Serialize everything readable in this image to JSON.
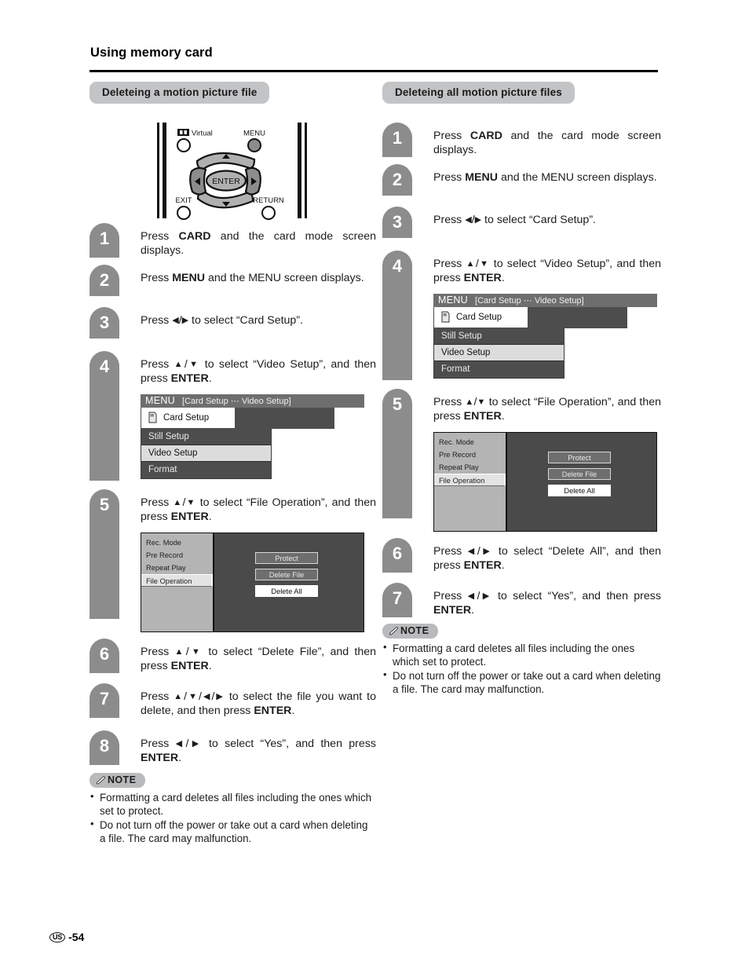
{
  "page": {
    "title": "Using memory card",
    "footer_region": "US",
    "footer_page": "-54"
  },
  "left_section": {
    "heading": "Deleteing a motion picture file",
    "remote": {
      "label_virtual": "Virtual",
      "label_menu": "MENU",
      "label_exit": "EXIT",
      "label_return": "RETURN",
      "label_enter": "ENTER"
    },
    "steps": [
      {
        "num": "1",
        "html": "Press <b>CARD</b> and the card mode screen displays."
      },
      {
        "num": "2",
        "html": "Press <b>MENU</b> and the MENU screen displays."
      },
      {
        "num": "3",
        "html": "Press <span class=\"arrow\">◀</span>/<span class=\"arrow\">▶</span> to select “Card Setup”."
      },
      {
        "num": "4",
        "html": "Press <span class=\"arrow\">▲</span>/<span class=\"arrow\">▼</span> to select “Video Setup”, and then press <b>ENTER</b>."
      },
      {
        "num": "5",
        "html": "Press <span class=\"arrow\">▲</span>/<span class=\"arrow\">▼</span> to select “File Operation”, and then press <b>ENTER</b>."
      },
      {
        "num": "6",
        "html": "Press <span class=\"arrow\">▲</span>/<span class=\"arrow\">▼</span> to select “Delete File”, and then press <b>ENTER</b>."
      },
      {
        "num": "7",
        "html": "Press <span class=\"arrow\">▲</span>/<span class=\"arrow\">▼</span>/<span class=\"arrow\">◀</span>/<span class=\"arrow\">▶</span> to select the file you want to delete, and then press <b>ENTER</b>."
      },
      {
        "num": "8",
        "html": "Press <span class=\"arrow\">◀</span>/<span class=\"arrow\">▶</span> to select “Yes”, and then press <b>ENTER</b>."
      }
    ],
    "note": {
      "badge": "NOTE",
      "items": [
        "Formatting a card deletes all files including the ones which set to protect.",
        "Do not turn off the power or take out a card when deleting a file. The card may malfunction."
      ]
    }
  },
  "right_section": {
    "heading": "Deleteing all motion picture files",
    "steps": [
      {
        "num": "1",
        "html": "Press <b>CARD</b> and the card mode screen displays."
      },
      {
        "num": "2",
        "html": "Press <b>MENU</b> and the MENU screen displays."
      },
      {
        "num": "3",
        "html": "Press <span class=\"arrow\">◀</span>/<span class=\"arrow\">▶</span> to select “Card Setup”."
      },
      {
        "num": "4",
        "html": "Press <span class=\"arrow\">▲</span>/<span class=\"arrow\">▼</span> to select “Video Setup”, and then press <b>ENTER</b>."
      },
      {
        "num": "5",
        "html": "Press <span class=\"arrow\">▲</span>/<span class=\"arrow\">▼</span> to select “File Operation”, and then press <b>ENTER</b>."
      },
      {
        "num": "6",
        "html": "Press <span class=\"arrow\">◀</span>/<span class=\"arrow\">▶</span> to select “Delete All”, and then press <b>ENTER</b>."
      },
      {
        "num": "7",
        "html": "Press <span class=\"arrow\">◀</span>/<span class=\"arrow\">▶</span> to select “Yes”, and then press <b>ENTER</b>."
      }
    ],
    "note": {
      "badge": "NOTE",
      "items": [
        "Formatting a card deletes all files including the ones which set to protect.",
        "Do not turn off the power or take out a card when deleting a file. The card may malfunction."
      ]
    }
  },
  "osd_menu": {
    "title": "MENU",
    "breadcrumb": "[Card Setup ⋯ Video Setup]",
    "tab_label": "Card Setup",
    "rows": [
      "Still Setup",
      "Video Setup",
      "Format"
    ],
    "selected_row": "Video Setup"
  },
  "osd_panel": {
    "left_items": [
      "Rec. Mode",
      "Pre Record",
      "Repeat Play",
      "File Operation"
    ],
    "left_selected": "File Operation",
    "buttons": [
      "Protect",
      "Delete File",
      "Delete All"
    ],
    "button_highlighted": "Delete All"
  },
  "colors": {
    "pill_gray": "#c3c4c6",
    "step_gray": "#8c8c8c",
    "osd_dark": "#4d4d4d",
    "osd_title": "#6e6e6e",
    "osd_select": "#dcdcdc"
  }
}
